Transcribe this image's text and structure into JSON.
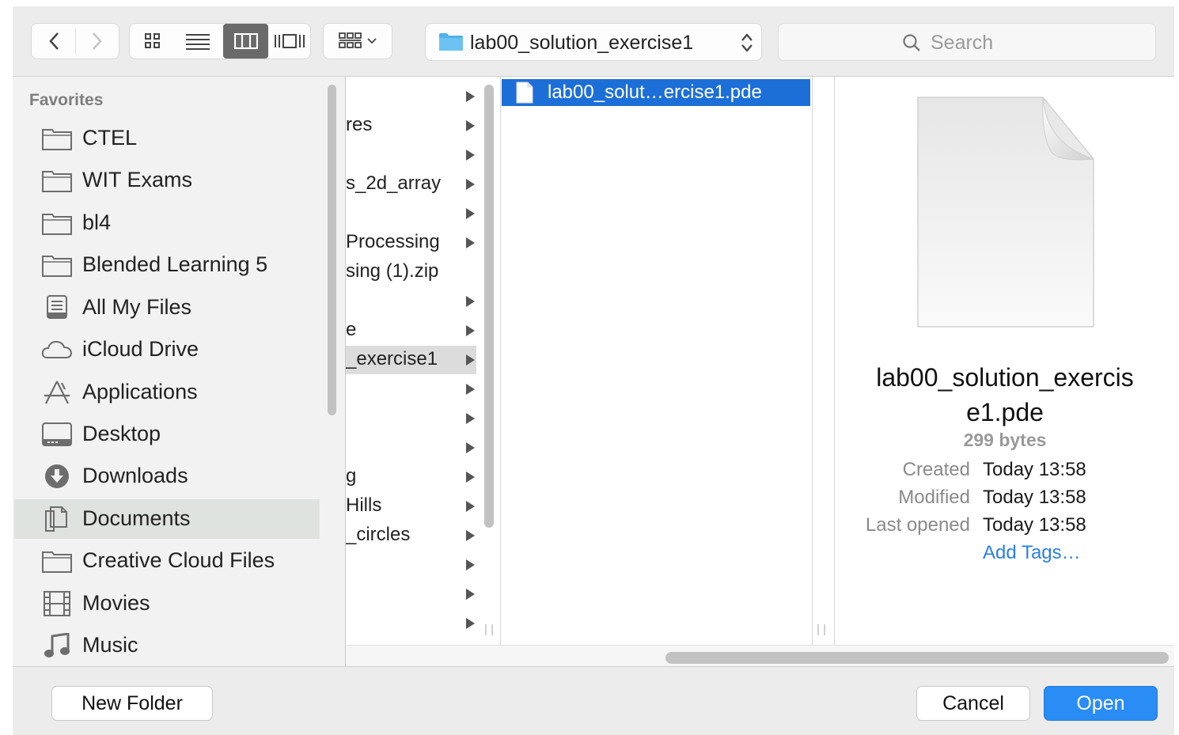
{
  "toolbar": {
    "path_label": "lab00_solution_exercise1",
    "search_placeholder": "Search",
    "nav_icons": [
      "chevron-left-icon",
      "chevron-right-icon"
    ],
    "view_icons": [
      "icon-view-icon",
      "list-view-icon",
      "column-view-icon",
      "cover-flow-icon",
      "arrange-icon"
    ]
  },
  "sidebar": {
    "heading": "Favorites",
    "items": [
      {
        "label": "CTEL",
        "icon": "folder-icon"
      },
      {
        "label": "WIT Exams",
        "icon": "folder-icon"
      },
      {
        "label": "bl4",
        "icon": "folder-icon"
      },
      {
        "label": "Blended Learning 5",
        "icon": "folder-icon"
      },
      {
        "label": "All My Files",
        "icon": "all-files-icon"
      },
      {
        "label": "iCloud Drive",
        "icon": "cloud-icon"
      },
      {
        "label": "Applications",
        "icon": "applications-icon"
      },
      {
        "label": "Desktop",
        "icon": "desktop-icon"
      },
      {
        "label": "Downloads",
        "icon": "downloads-icon"
      },
      {
        "label": "Documents",
        "icon": "documents-icon",
        "selected": true
      },
      {
        "label": "Creative Cloud Files",
        "icon": "folder-icon"
      },
      {
        "label": "Movies",
        "icon": "movies-icon"
      },
      {
        "label": "Music",
        "icon": "music-icon"
      }
    ]
  },
  "column1": {
    "rows": [
      {
        "text": "",
        "arrow": true
      },
      {
        "text": "res",
        "arrow": true
      },
      {
        "text": "",
        "arrow": true
      },
      {
        "text": "s_2d_array",
        "arrow": true
      },
      {
        "text": "",
        "arrow": true
      },
      {
        "text": "Processing",
        "arrow": true
      },
      {
        "text": "sing (1).zip",
        "arrow": false
      },
      {
        "text": "",
        "arrow": true
      },
      {
        "text": "e",
        "arrow": true
      },
      {
        "text": "_exercise1",
        "arrow": true,
        "selected": true
      },
      {
        "text": "",
        "arrow": true
      },
      {
        "text": "",
        "arrow": true
      },
      {
        "text": "",
        "arrow": true
      },
      {
        "text": "g",
        "arrow": true
      },
      {
        "text": "Hills",
        "arrow": true
      },
      {
        "text": "_circles",
        "arrow": true
      },
      {
        "text": "",
        "arrow": true
      },
      {
        "text": "",
        "arrow": true
      },
      {
        "text": "",
        "arrow": true
      }
    ]
  },
  "column2": {
    "file": "lab00_solut…ercise1.pde"
  },
  "preview": {
    "name_line1": "lab00_solution_exercis",
    "name_line2": "e1.pde",
    "size": "299 bytes",
    "meta": [
      {
        "key": "Created",
        "value": "Today 13:58"
      },
      {
        "key": "Modified",
        "value": "Today 13:58"
      },
      {
        "key": "Last opened",
        "value": "Today 13:58"
      }
    ],
    "add_tags": "Add Tags…"
  },
  "footer": {
    "new_folder": "New Folder",
    "cancel": "Cancel",
    "open": "Open"
  },
  "colors": {
    "selection": "#1d6fd8",
    "primary_button": "#2a8cf5",
    "link": "#2d7fe6"
  }
}
